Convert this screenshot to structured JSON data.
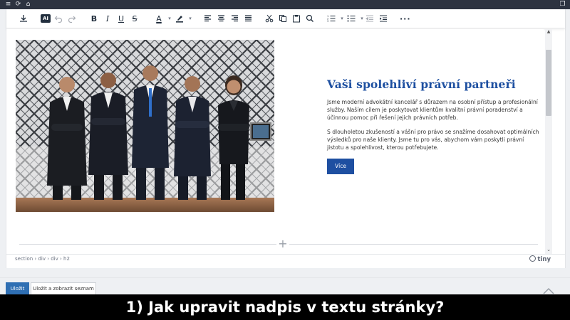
{
  "topbar": {
    "icons": [
      "menu-icon",
      "refresh-icon",
      "home-icon",
      "window-icon"
    ]
  },
  "toolbar": {
    "ai_label": "AI",
    "bold": "B",
    "italic": "I",
    "underline": "U",
    "strike": "S",
    "text_color": "A",
    "icons": [
      "download-icon",
      "undo-icon",
      "redo-icon",
      "highlight-icon",
      "align-left-icon",
      "align-center-icon",
      "align-right-icon",
      "justify-icon",
      "cut-icon",
      "copy-icon",
      "paste-icon",
      "search-icon",
      "numbered-list-icon",
      "bullet-list-icon",
      "outdent-icon",
      "indent-icon",
      "more-icon"
    ]
  },
  "content": {
    "heading": "Vaši spolehliví právní partneři",
    "paragraph1": "Jsme moderní advokátní kancelář s důrazem na osobní přístup a profesionální služby. Naším cílem je poskytovat klientům kvalitní právní poradenství a účinnou pomoc při řešení jejich právních potřeb.",
    "paragraph2": " S dlouholetou zkušeností a vášní pro právo se snažíme dosahovat optimálních výsledků pro naše klienty. Jsme tu pro vás, abychom vám poskytli právní jistotu a spolehlivost, kterou potřebujete.",
    "button": "Více"
  },
  "statusbar": {
    "path": "section › div › div › h2",
    "brand": "tiny"
  },
  "actions": {
    "save": "Uložit",
    "save_list": "Uložit a zobrazit seznam"
  },
  "caption": "1) Jak upravit nadpis v textu stránky?",
  "colors": {
    "heading": "#1d4fa0",
    "button": "#1e4fa1",
    "primary": "#2f6fb3"
  }
}
